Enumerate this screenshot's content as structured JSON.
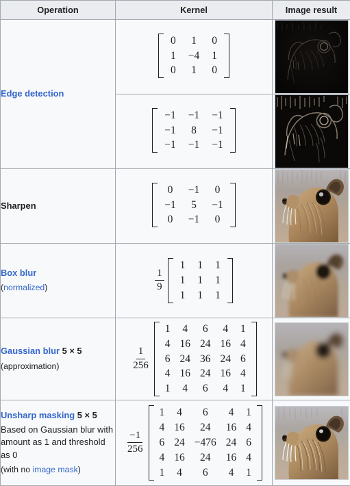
{
  "table": {
    "headers": [
      "Operation",
      "Kernel",
      "Image result"
    ],
    "rows": [
      {
        "id": "edge-detection",
        "operation": {
          "title": "Edge detection",
          "title_is_link": true,
          "dimension": "",
          "description": "",
          "note": "",
          "note_link": ""
        },
        "kernels": [
          {
            "coefficient_numerator": "",
            "coefficient_denominator": "",
            "values": [
              [
                "0",
                "1",
                "0"
              ],
              [
                "1",
                "−4",
                "1"
              ],
              [
                "0",
                "1",
                "0"
              ]
            ],
            "image_alt": "edge-detection-laplacian-result"
          },
          {
            "coefficient_numerator": "",
            "coefficient_denominator": "",
            "values": [
              [
                "−1",
                "−1",
                "−1"
              ],
              [
                "−1",
                "8",
                "−1"
              ],
              [
                "−1",
                "−1",
                "−1"
              ]
            ],
            "image_alt": "edge-detection-strong-result"
          }
        ]
      },
      {
        "id": "sharpen",
        "operation": {
          "title": "Sharpen",
          "title_is_link": false,
          "dimension": "",
          "description": "",
          "note": "",
          "note_link": ""
        },
        "kernels": [
          {
            "coefficient_numerator": "",
            "coefficient_denominator": "",
            "values": [
              [
                "0",
                "−1",
                "0"
              ],
              [
                "−1",
                "5",
                "−1"
              ],
              [
                "0",
                "−1",
                "0"
              ]
            ],
            "image_alt": "sharpen-result"
          }
        ]
      },
      {
        "id": "box-blur",
        "operation": {
          "title": "Box blur",
          "title_is_link": true,
          "dimension": "",
          "description": "",
          "note_prefix": "(",
          "note_link": "normalized",
          "note_suffix": ")"
        },
        "kernels": [
          {
            "coefficient_numerator": "1",
            "coefficient_denominator": "9",
            "values": [
              [
                "1",
                "1",
                "1"
              ],
              [
                "1",
                "1",
                "1"
              ],
              [
                "1",
                "1",
                "1"
              ]
            ],
            "image_alt": "box-blur-result"
          }
        ]
      },
      {
        "id": "gaussian-blur",
        "operation": {
          "title": "Gaussian blur",
          "title_is_link": true,
          "dimension": "5 × 5",
          "description": "",
          "note_prefix": "",
          "note_plain": "(approximation)",
          "note_link": "",
          "note_suffix": ""
        },
        "kernels": [
          {
            "coefficient_numerator": "1",
            "coefficient_denominator": "256",
            "values": [
              [
                "1",
                "4",
                "6",
                "4",
                "1"
              ],
              [
                "4",
                "16",
                "24",
                "16",
                "4"
              ],
              [
                "6",
                "24",
                "36",
                "24",
                "6"
              ],
              [
                "4",
                "16",
                "24",
                "16",
                "4"
              ],
              [
                "1",
                "4",
                "6",
                "4",
                "1"
              ]
            ],
            "image_alt": "gaussian-blur-result"
          }
        ]
      },
      {
        "id": "unsharp-masking",
        "operation": {
          "title": "Unsharp masking",
          "title_is_link": true,
          "dimension": "5 × 5",
          "description": "Based on Gaussian blur with amount as 1 and threshold as 0",
          "note_prefix": "(with no ",
          "note_link": "image mask",
          "note_suffix": ")"
        },
        "kernels": [
          {
            "coefficient_numerator": "−1",
            "coefficient_denominator": "256",
            "values": [
              [
                "1",
                "4",
                "6",
                "4",
                "1"
              ],
              [
                "4",
                "16",
                "24",
                "16",
                "4"
              ],
              [
                "6",
                "24",
                "−476",
                "24",
                "6"
              ],
              [
                "4",
                "16",
                "24",
                "16",
                "4"
              ],
              [
                "1",
                "4",
                "6",
                "4",
                "1"
              ]
            ],
            "image_alt": "unsharp-masking-result"
          }
        ]
      }
    ]
  },
  "colors": {
    "link": "#3366cc",
    "header_bg": "#eaecf0",
    "cell_bg": "#f8f9fa",
    "border": "#a2a9b1",
    "text": "#202122"
  }
}
